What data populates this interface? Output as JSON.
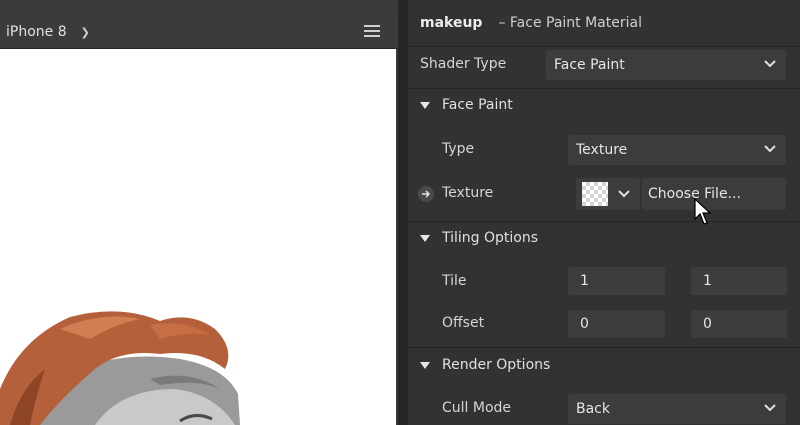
{
  "preview": {
    "device": "iPhone 8"
  },
  "inspector": {
    "title": "makeup",
    "subtitle": "– Face Paint Material",
    "shader_type": {
      "label": "Shader Type",
      "value": "Face Paint"
    },
    "face_paint": {
      "section": "Face Paint",
      "type": {
        "label": "Type",
        "value": "Texture"
      },
      "texture": {
        "label": "Texture",
        "choose": "Choose File..."
      }
    },
    "tiling": {
      "section": "Tiling Options",
      "tile": {
        "label": "Tile",
        "x": "1",
        "y": "1"
      },
      "offset": {
        "label": "Offset",
        "x": "0",
        "y": "0"
      }
    },
    "render": {
      "section": "Render Options",
      "cull_mode": {
        "label": "Cull Mode",
        "value": "Back"
      }
    }
  },
  "colors": {
    "panel": "#323232",
    "field": "#3c3c3c",
    "hair": "#b4603a"
  }
}
